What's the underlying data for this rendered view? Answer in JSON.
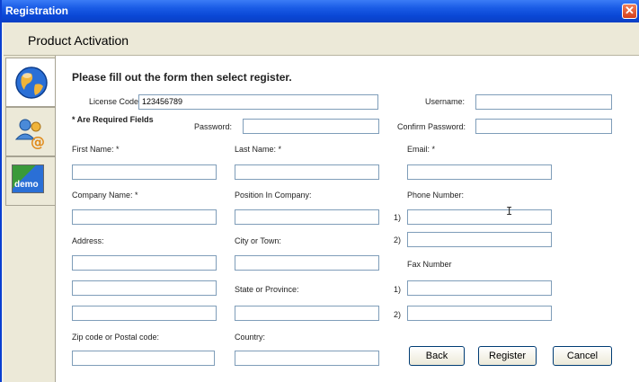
{
  "window": {
    "title": "Registration",
    "close_label": "✕"
  },
  "header": {
    "title": "Product Activation"
  },
  "sidebar": {
    "tabs": [
      {
        "icon": "globe-icon"
      },
      {
        "icon": "email-contacts-icon"
      },
      {
        "icon": "demo-icon",
        "label": "demo"
      }
    ]
  },
  "form": {
    "instructions": "Please fill out the form then select register.",
    "required_note": "* Are Required Fields",
    "license_code": {
      "label": "License Code:",
      "value": "123456789"
    },
    "username": {
      "label": "Username:",
      "value": ""
    },
    "password": {
      "label": "Password:",
      "value": ""
    },
    "confirm_password": {
      "label": "Confirm Password:",
      "value": ""
    },
    "first_name": {
      "label": "First Name: *",
      "value": ""
    },
    "last_name": {
      "label": "Last Name: *",
      "value": ""
    },
    "email": {
      "label": "Email: *",
      "value": ""
    },
    "company_name": {
      "label": "Company Name: *",
      "value": ""
    },
    "position": {
      "label": "Position In Company:",
      "value": ""
    },
    "phone_number": {
      "label": "Phone Number:",
      "line1_marker": "1)",
      "line2_marker": "2)"
    },
    "address": {
      "label": "Address:"
    },
    "city": {
      "label": "City or Town:",
      "value": ""
    },
    "fax_number": {
      "label": "Fax Number",
      "line1_marker": "1)",
      "line2_marker": "2)"
    },
    "state": {
      "label": "State or Province:",
      "value": ""
    },
    "zip": {
      "label": "Zip code or Postal code:",
      "value": ""
    },
    "country": {
      "label": "Country:",
      "value": ""
    }
  },
  "buttons": {
    "back": "Back",
    "register": "Register",
    "cancel": "Cancel"
  },
  "colors": {
    "titlebar": "#0a47d6",
    "input_border": "#7f9db9",
    "panel": "#ece9d8"
  }
}
